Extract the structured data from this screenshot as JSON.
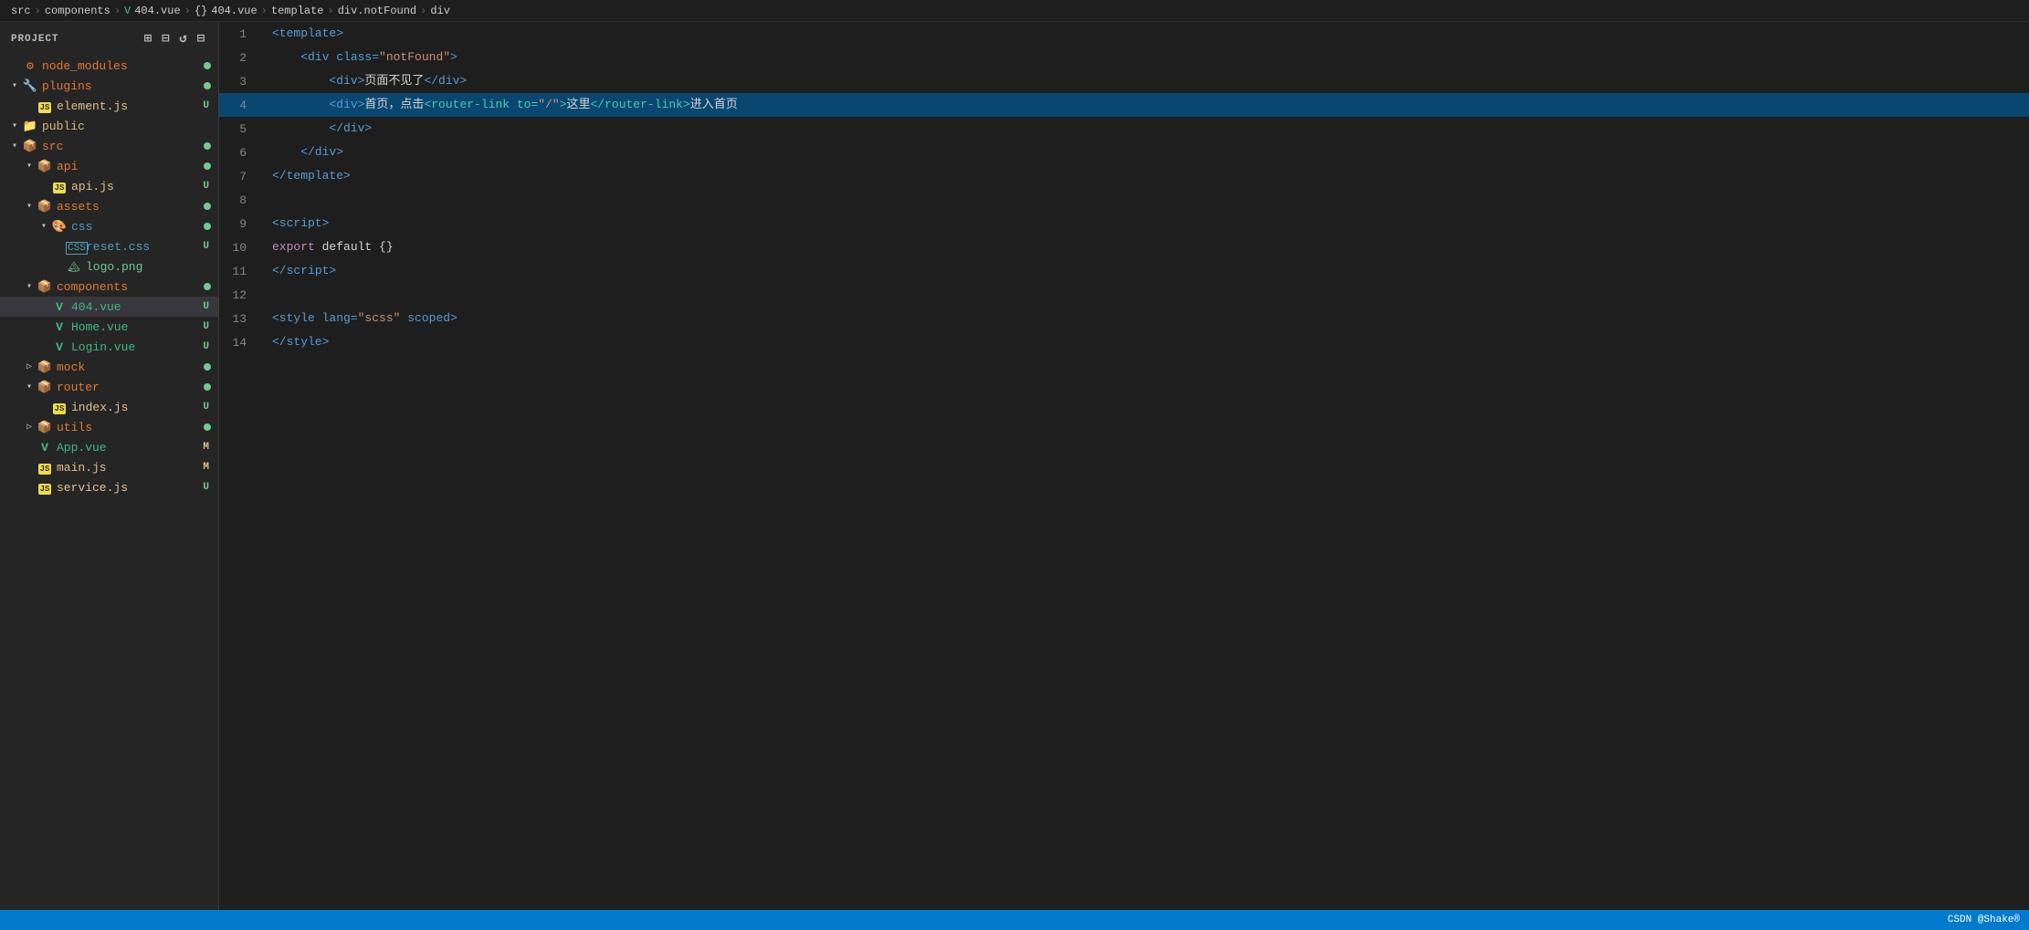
{
  "breadcrumb": {
    "items": [
      "src",
      "components",
      "404.vue",
      "{}",
      "404.vue",
      "template",
      "div.notFound",
      "div"
    ]
  },
  "sidebar": {
    "title": "PROJECT",
    "icons": [
      {
        "name": "new-file-icon",
        "symbol": "📄"
      },
      {
        "name": "new-folder-icon",
        "symbol": "📁"
      },
      {
        "name": "refresh-icon",
        "symbol": "↺"
      },
      {
        "name": "collapse-icon",
        "symbol": "⊟"
      }
    ],
    "tree": [
      {
        "id": 1,
        "indent": 0,
        "chevron": "",
        "icon_type": "module",
        "name": "node_modules",
        "badge": "",
        "dot": true,
        "color": "color-orange",
        "active": false
      },
      {
        "id": 2,
        "indent": 0,
        "chevron": "▾",
        "icon_type": "plugin",
        "name": "plugins",
        "badge": "",
        "dot": true,
        "color": "color-orange",
        "active": false
      },
      {
        "id": 3,
        "indent": 1,
        "chevron": "",
        "icon_type": "js",
        "name": "element.js",
        "badge": "U",
        "dot": false,
        "color": "color-yellow",
        "active": false
      },
      {
        "id": 4,
        "indent": 0,
        "chevron": "▾",
        "icon_type": "folder",
        "name": "public",
        "badge": "",
        "dot": false,
        "color": "color-folder",
        "active": false
      },
      {
        "id": 5,
        "indent": 0,
        "chevron": "▾",
        "icon_type": "src",
        "name": "src",
        "badge": "",
        "dot": true,
        "color": "color-orange",
        "active": false
      },
      {
        "id": 6,
        "indent": 1,
        "chevron": "▾",
        "icon_type": "api",
        "name": "api",
        "badge": "",
        "dot": true,
        "color": "color-orange",
        "active": false
      },
      {
        "id": 7,
        "indent": 2,
        "chevron": "",
        "icon_type": "js",
        "name": "api.js",
        "badge": "U",
        "dot": false,
        "color": "color-yellow",
        "active": false
      },
      {
        "id": 8,
        "indent": 1,
        "chevron": "▾",
        "icon_type": "assets",
        "name": "assets",
        "badge": "",
        "dot": true,
        "color": "color-orange",
        "active": false
      },
      {
        "id": 9,
        "indent": 2,
        "chevron": "▾",
        "icon_type": "css",
        "name": "css",
        "badge": "",
        "dot": true,
        "color": "color-blue",
        "active": false
      },
      {
        "id": 10,
        "indent": 3,
        "chevron": "",
        "icon_type": "css_file",
        "name": "reset.css",
        "badge": "U",
        "dot": false,
        "color": "color-blue",
        "active": false
      },
      {
        "id": 11,
        "indent": 3,
        "chevron": "",
        "icon_type": "image",
        "name": "logo.png",
        "badge": "",
        "dot": false,
        "color": "color-green",
        "active": false
      },
      {
        "id": 12,
        "indent": 1,
        "chevron": "▾",
        "icon_type": "components",
        "name": "components",
        "badge": "",
        "dot": true,
        "color": "color-orange",
        "active": false
      },
      {
        "id": 13,
        "indent": 2,
        "chevron": "",
        "icon_type": "vue",
        "name": "404.vue",
        "badge": "U",
        "dot": false,
        "color": "color-vue",
        "active": true
      },
      {
        "id": 14,
        "indent": 2,
        "chevron": "",
        "icon_type": "vue",
        "name": "Home.vue",
        "badge": "U",
        "dot": false,
        "color": "color-vue",
        "active": false
      },
      {
        "id": 15,
        "indent": 2,
        "chevron": "",
        "icon_type": "vue",
        "name": "Login.vue",
        "badge": "U",
        "dot": false,
        "color": "color-vue",
        "active": false
      },
      {
        "id": 16,
        "indent": 1,
        "chevron": "▷",
        "icon_type": "mock",
        "name": "mock",
        "badge": "",
        "dot": true,
        "color": "color-orange",
        "active": false
      },
      {
        "id": 17,
        "indent": 1,
        "chevron": "▾",
        "icon_type": "router",
        "name": "router",
        "badge": "",
        "dot": true,
        "color": "color-orange",
        "active": false
      },
      {
        "id": 18,
        "indent": 2,
        "chevron": "",
        "icon_type": "js",
        "name": "index.js",
        "badge": "U",
        "dot": false,
        "color": "color-yellow",
        "active": false
      },
      {
        "id": 19,
        "indent": 1,
        "chevron": "▷",
        "icon_type": "utils",
        "name": "utils",
        "badge": "",
        "dot": true,
        "color": "color-orange",
        "active": false
      },
      {
        "id": 20,
        "indent": 1,
        "chevron": "",
        "icon_type": "vue",
        "name": "App.vue",
        "badge": "M",
        "dot": false,
        "color": "color-vue",
        "active": false
      },
      {
        "id": 21,
        "indent": 1,
        "chevron": "",
        "icon_type": "js",
        "name": "main.js",
        "badge": "M",
        "dot": false,
        "color": "color-yellow",
        "active": false
      },
      {
        "id": 22,
        "indent": 1,
        "chevron": "",
        "icon_type": "js",
        "name": "service.js",
        "badge": "U",
        "dot": false,
        "color": "color-yellow",
        "active": false
      }
    ]
  },
  "editor": {
    "lines": [
      {
        "num": 1,
        "tokens": [
          {
            "t": "<template>",
            "c": "s-tag"
          }
        ],
        "highlighted": false
      },
      {
        "num": 2,
        "tokens": [
          {
            "t": "    <div class=",
            "c": "s-tag"
          },
          {
            "t": "\"notFound\"",
            "c": "s-string"
          },
          {
            "t": ">",
            "c": "s-tag"
          }
        ],
        "highlighted": false
      },
      {
        "num": 3,
        "tokens": [
          {
            "t": "        <div>",
            "c": "s-tag"
          },
          {
            "t": "页面不见了",
            "c": "s-chinese"
          },
          {
            "t": "</div>",
            "c": "s-tag"
          }
        ],
        "highlighted": false
      },
      {
        "num": 4,
        "tokens": [
          {
            "t": "        <div>",
            "c": "s-tag"
          },
          {
            "t": "首页，点击",
            "c": "s-chinese"
          },
          {
            "t": "<router-link to=",
            "c": "s-routerlink"
          },
          {
            "t": "\"/\"",
            "c": "s-string"
          },
          {
            "t": ">",
            "c": "s-routerlink"
          },
          {
            "t": "这里",
            "c": "s-chinese"
          },
          {
            "t": "</router-link>",
            "c": "s-routerlink"
          },
          {
            "t": "进入首页",
            "c": "s-chinese"
          }
        ],
        "highlighted": true
      },
      {
        "num": 5,
        "tokens": [
          {
            "t": "        </div>",
            "c": "s-tag"
          }
        ],
        "highlighted": false
      },
      {
        "num": 6,
        "tokens": [
          {
            "t": "    </div>",
            "c": "s-tag"
          }
        ],
        "highlighted": false
      },
      {
        "num": 7,
        "tokens": [
          {
            "t": "</template>",
            "c": "s-tag"
          }
        ],
        "highlighted": false
      },
      {
        "num": 8,
        "tokens": [],
        "highlighted": false
      },
      {
        "num": 9,
        "tokens": [
          {
            "t": "<script>",
            "c": "s-tag"
          }
        ],
        "highlighted": false
      },
      {
        "num": 10,
        "tokens": [
          {
            "t": "export",
            "c": "s-keyword"
          },
          {
            "t": " default ",
            "c": "s-white"
          },
          {
            "t": "{}",
            "c": "s-white"
          }
        ],
        "highlighted": false
      },
      {
        "num": 11,
        "tokens": [
          {
            "t": "</",
            "c": "s-tag"
          },
          {
            "t": "script",
            "c": "s-tag"
          },
          {
            "t": ">",
            "c": "s-tag"
          }
        ],
        "highlighted": false
      },
      {
        "num": 12,
        "tokens": [],
        "highlighted": false
      },
      {
        "num": 13,
        "tokens": [
          {
            "t": "<style lang=",
            "c": "s-tag"
          },
          {
            "t": "\"scss\"",
            "c": "s-string"
          },
          {
            "t": " scoped>",
            "c": "s-tag"
          }
        ],
        "highlighted": false
      },
      {
        "num": 14,
        "tokens": [
          {
            "t": "</style>",
            "c": "s-tag"
          }
        ],
        "highlighted": false
      }
    ]
  },
  "status_bar": {
    "right_items": [
      "CSDN @Shake®"
    ]
  }
}
